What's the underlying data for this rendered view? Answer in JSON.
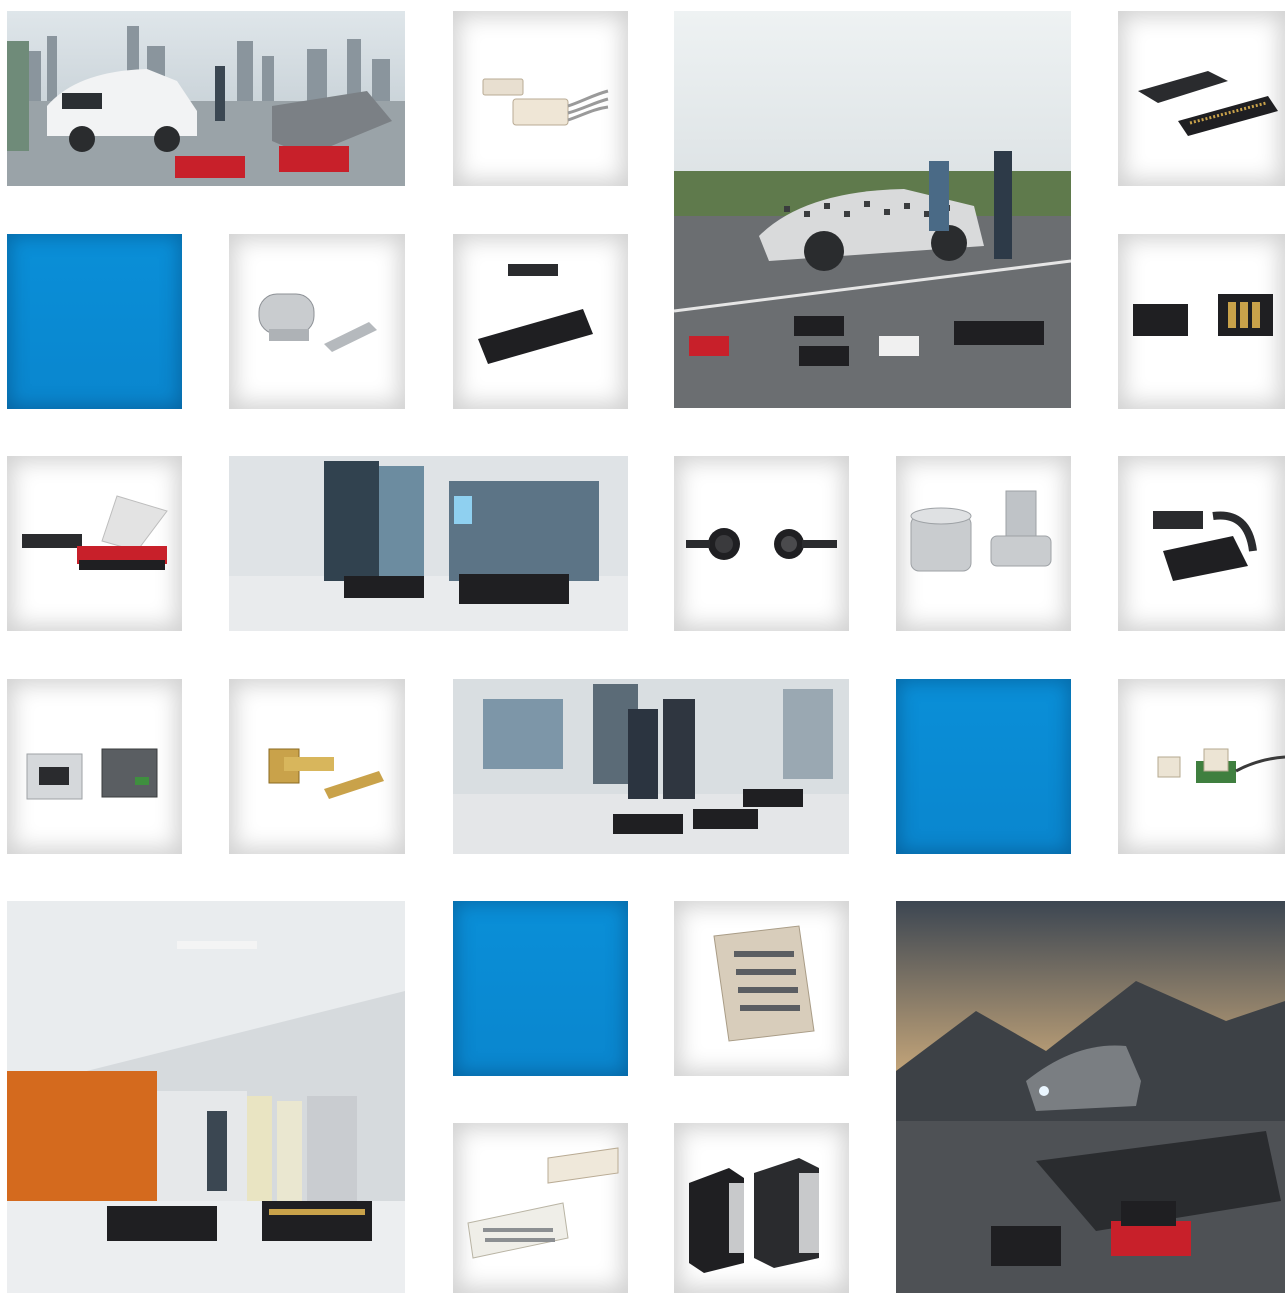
{
  "grid": {
    "tiles": [
      {
        "id": "ev-charging-scene",
        "kind": "scene",
        "subject": "electric-car-charging-city-scene"
      },
      {
        "id": "wire-to-board-white",
        "kind": "product",
        "subject": "white-wire-to-board-connector"
      },
      {
        "id": "test-track-scene",
        "kind": "scene",
        "subject": "camouflaged-sports-car-test-track"
      },
      {
        "id": "board-to-board-black",
        "kind": "product",
        "subject": "black-board-to-board-connector"
      },
      {
        "id": "blue-1",
        "kind": "accent"
      },
      {
        "id": "press-fit-pin",
        "kind": "product",
        "subject": "metal-press-fit-contact"
      },
      {
        "id": "header-black-1",
        "kind": "product",
        "subject": "black-pin-header"
      },
      {
        "id": "power-connector-gold",
        "kind": "product",
        "subject": "black-power-connector-gold-contacts"
      },
      {
        "id": "ribbon-connector-red",
        "kind": "product",
        "subject": "red-ribbon-cable-connector"
      },
      {
        "id": "industrial-cabinet-scene",
        "kind": "scene",
        "subject": "industrial-control-cabinet"
      },
      {
        "id": "circular-connector",
        "kind": "product",
        "subject": "circular-m-connector"
      },
      {
        "id": "standoff-screw",
        "kind": "product",
        "subject": "smd-standoff-and-screw"
      },
      {
        "id": "cable-housing-black",
        "kind": "product",
        "subject": "black-cable-housing"
      },
      {
        "id": "rj45-jack",
        "kind": "product",
        "subject": "rj45-modular-jack"
      },
      {
        "id": "rf-connector-gold",
        "kind": "product",
        "subject": "gold-rf-connector"
      },
      {
        "id": "factory-meeting-scene",
        "kind": "scene",
        "subject": "factory-meeting-with-connectors"
      },
      {
        "id": "blue-2",
        "kind": "accent"
      },
      {
        "id": "small-board-connector",
        "kind": "product",
        "subject": "small-board-connector-on-pcb"
      },
      {
        "id": "machine-hall-scene",
        "kind": "scene",
        "subject": "machine-hall-drive-units"
      },
      {
        "id": "blue-3",
        "kind": "accent"
      },
      {
        "id": "backplane-connector",
        "kind": "product",
        "subject": "backplane-connector-tan"
      },
      {
        "id": "night-road-scene",
        "kind": "scene",
        "subject": "suv-headlight-mountain-road"
      },
      {
        "id": "din-connector-white",
        "kind": "product",
        "subject": "din-41612-connector"
      },
      {
        "id": "power-module-black",
        "kind": "product",
        "subject": "black-power-modules"
      }
    ]
  },
  "colors": {
    "accent_blue": "#0a8bd4",
    "connector_black": "#1f1f22",
    "connector_red": "#c8202a",
    "gold": "#c9a24a",
    "sky": "#c9d6df"
  }
}
